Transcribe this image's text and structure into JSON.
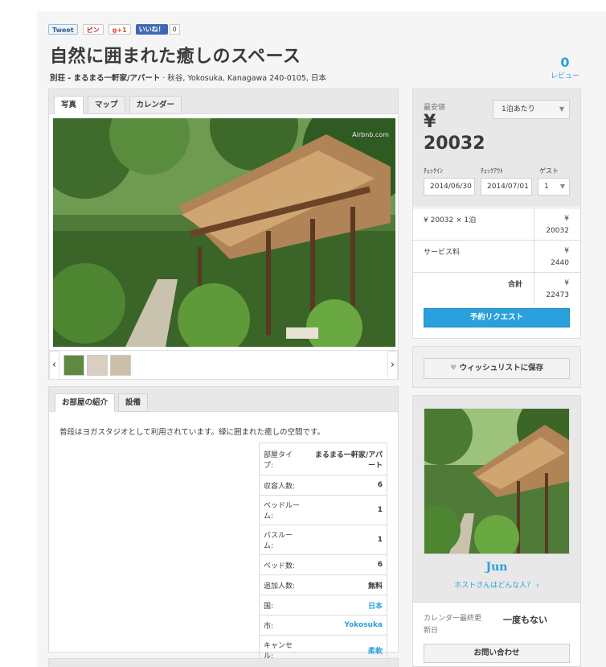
{
  "social": {
    "tweet": "Tweet",
    "pin": "ピン",
    "gplus": "g+1",
    "fb_like": "いいね！",
    "fb_count": "0"
  },
  "listing": {
    "title": "自然に囲まれた癒しのスペース",
    "subtitle_type": "別荘 - まるまる一軒家/アパート",
    "subtitle_location": " · 秋谷, Yokosuka, Kanagawa 240-0105, 日本",
    "review_count": "0",
    "review_label": "レビュー"
  },
  "photo_tabs": [
    "写真",
    "マップ",
    "カレンダー"
  ],
  "photo": {
    "watermark": "Airbnb.com"
  },
  "about": {
    "tabs": [
      "お部屋の紹介",
      "設備"
    ],
    "description": "普段はヨガスタジオとして利用されています。緑に囲まれた癒しの空間です。",
    "specs": [
      {
        "key": "部屋タイプ:",
        "value": "まるまる一軒家/アパート",
        "link": false
      },
      {
        "key": "収容人数:",
        "value": "6",
        "link": false
      },
      {
        "key": "ベッドルーム:",
        "value": "1",
        "link": false
      },
      {
        "key": "バスルーム:",
        "value": "1",
        "link": false
      },
      {
        "key": "ベッド数:",
        "value": "6",
        "link": false
      },
      {
        "key": "追加人数:",
        "value": "無料",
        "link": false
      },
      {
        "key": "国:",
        "value": "日本",
        "link": true
      },
      {
        "key": "市:",
        "value": "Yokosuka",
        "link": true
      },
      {
        "key": "キャンセル:",
        "value": "柔軟",
        "link": true
      }
    ]
  },
  "booking": {
    "lowest_label": "最安値",
    "currency": "¥",
    "price": "20032",
    "per_option": "1泊あたり",
    "checkin_label": "ﾁｪｯｸｲﾝ",
    "checkout_label": "ﾁｪｯｸｱｳﾄ",
    "guest_label": "ゲスト",
    "checkin": "2014/06/30",
    "checkout": "2014/07/01",
    "guests": "1",
    "line1_label": "¥ 20032 × 1泊",
    "line1_currency": "¥",
    "line1_value": "20032",
    "service_label": "サービス料",
    "service_currency": "¥",
    "service_value": "2440",
    "total_label": "合計",
    "total_currency": "¥",
    "total_value": "22473",
    "request_button": "予約リクエスト"
  },
  "wishlist": {
    "button": "ウィッシュリストに保存"
  },
  "host": {
    "name": "Jun",
    "link": "ホストさんはどんな人？",
    "calendar_label_1": "カレンダー最終更",
    "calendar_label_2": "新日",
    "calendar_value": "一度もない",
    "contact_button": "お問い合わせ"
  },
  "colors": {
    "accent": "#2aa1dc",
    "panel_bg": "#f5f5f5"
  }
}
